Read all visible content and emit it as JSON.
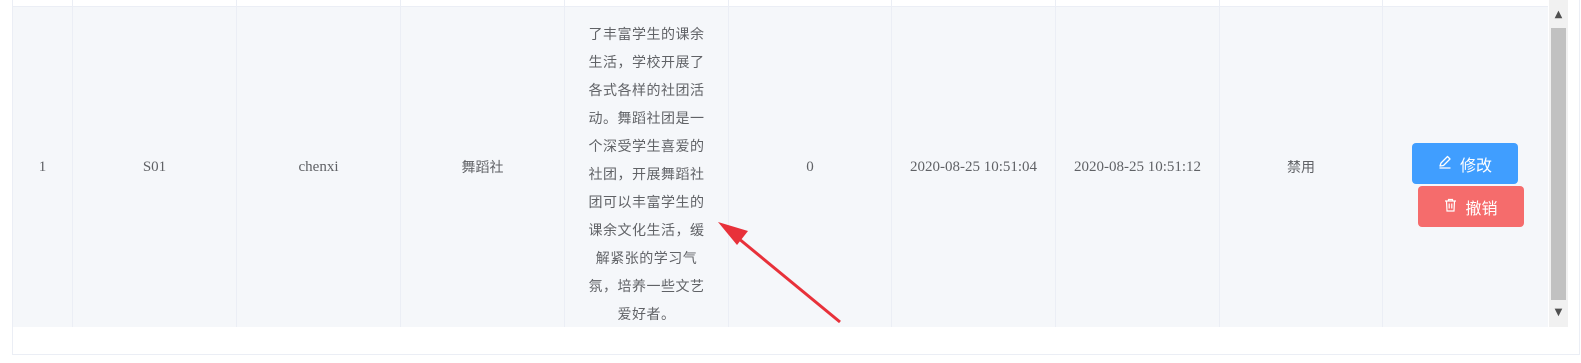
{
  "row": {
    "index": "1",
    "code": "S01",
    "user": "chenxi",
    "club_name": "舞蹈社",
    "description": "了丰富学生的课余\n生活，学校开展了\n各式各样的社团活\n动。舞蹈社团是一\n个深受学生喜爱的\n社团，开展舞蹈社\n团可以丰富学生的\n课余文化生活，缓\n解紧张的学习气\n氛，培养一些文艺\n爱好者。",
    "count": "0",
    "created_time": "2020-08-25 10:51:04",
    "updated_time": "2020-08-25 10:51:12",
    "status": "禁用"
  },
  "actions": {
    "edit_label": "修改",
    "revoke_label": "撤销",
    "edit_icon": "edit-icon",
    "revoke_icon": "trash-icon"
  },
  "colors": {
    "edit": "#409eff",
    "revoke": "#f56c6c",
    "annotation_arrow": "#e8313a"
  }
}
